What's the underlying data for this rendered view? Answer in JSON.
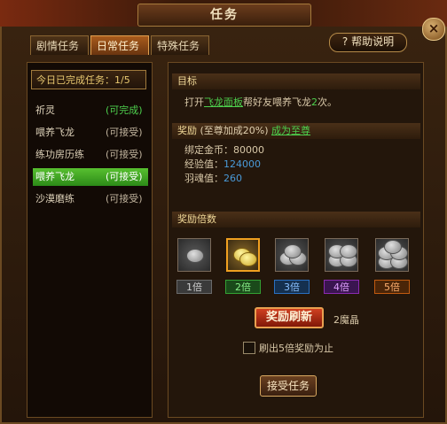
{
  "window": {
    "title": "任务",
    "close_icon": "×"
  },
  "tabs": [
    {
      "label": "剧情任务"
    },
    {
      "label": "日常任务"
    },
    {
      "label": "特殊任务"
    }
  ],
  "help": {
    "label": "? 帮助说明"
  },
  "left": {
    "header": "今日已完成任务：1/5",
    "tasks": [
      {
        "name": "祈灵",
        "status": "(可完成)"
      },
      {
        "name": "喂养飞龙",
        "status": "(可接受)"
      },
      {
        "name": "练功房历练",
        "status": "(可接受)"
      },
      {
        "name": "喂养飞龙",
        "status": "(可接受)"
      },
      {
        "name": "沙漠磨练",
        "status": "(可接受)"
      }
    ],
    "selected_index": 3
  },
  "goal": {
    "header": "目标",
    "prefix": "打开",
    "link": "飞龙面板",
    "middle": "帮好友喂养飞龙",
    "count": "2",
    "suffix": "次。"
  },
  "reward": {
    "header": "奖励",
    "bonus": "(至尊加成20%)",
    "link": "成为至尊",
    "gold_label": "绑定金币：",
    "gold_value": "80000",
    "exp_label": "经验值：",
    "exp_value": "124000",
    "soul_label": "羽魂值：",
    "soul_value": "260"
  },
  "multiplier": {
    "header": "奖励倍数",
    "slots": [
      {
        "label": "1倍",
        "color": "#7a7a7a"
      },
      {
        "label": "2倍",
        "color": "#33a033"
      },
      {
        "label": "3倍",
        "color": "#2a6fc0"
      },
      {
        "label": "4倍",
        "color": "#8a2ab0"
      },
      {
        "label": "5倍",
        "color": "#c05a10"
      }
    ],
    "active_index": 1,
    "refresh_label": "奖励刷新",
    "cost": "2魔晶",
    "auto_label": "刷出5倍奖励为止"
  },
  "accept": {
    "label": "接受任务"
  },
  "colors": {
    "accent": "#e0a050",
    "green": "#4dd04d",
    "blue": "#4a9ad8"
  }
}
